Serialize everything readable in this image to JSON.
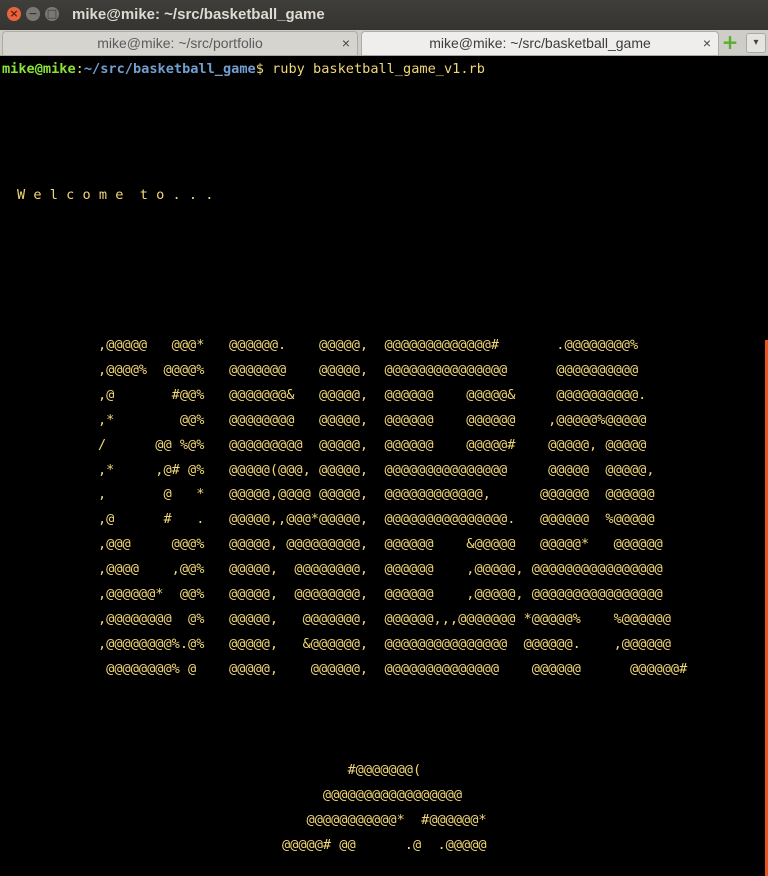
{
  "window": {
    "title": "mike@mike: ~/src/basketball_game",
    "close_icon": "×",
    "minimize_icon": "−",
    "maximize_icon": "□"
  },
  "tabs": [
    {
      "label": "mike@mike: ~/src/portfolio",
      "active": false,
      "close": "×"
    },
    {
      "label": "mike@mike: ~/src/basketball_game",
      "active": true,
      "close": "×"
    }
  ],
  "new_tab_icon": "+",
  "menu_icon": "▾",
  "terminal": {
    "prompt_user": "mike@mike",
    "prompt_colon": ":",
    "prompt_path": "~/src/basketball_game",
    "prompt_symbol": "$",
    "command": " ruby basketball_game_v1.rb",
    "welcome": "W e l c o m e  t o . . .",
    "art": ",@@@@@   @@@*   @@@@@@.    @@@@@,  @@@@@@@@@@@@@#       .@@@@@@@@%\n,@@@@%  @@@@%   @@@@@@@    @@@@@,  @@@@@@@@@@@@@@@      @@@@@@@@@@\n,@       #@@%   @@@@@@@&   @@@@@,  @@@@@@    @@@@@&     @@@@@@@@@@.\n,*        @@%   @@@@@@@@   @@@@@,  @@@@@@    @@@@@@    ,@@@@@%@@@@@\n/      @@ %@%   @@@@@@@@@  @@@@@,  @@@@@@    @@@@@#    @@@@@, @@@@@\n,*     ,@# @%   @@@@@(@@@, @@@@@,  @@@@@@@@@@@@@@@     @@@@@  @@@@@,\n,       @   *   @@@@@,@@@@ @@@@@,  @@@@@@@@@@@@,      @@@@@@  @@@@@@\n,@      #   .   @@@@@,,@@@*@@@@@,  @@@@@@@@@@@@@@@.   @@@@@@  %@@@@@\n,@@@     @@@%   @@@@@, @@@@@@@@@,  @@@@@@    &@@@@@   @@@@@*   @@@@@@\n,@@@@    ,@@%   @@@@@,  @@@@@@@@,  @@@@@@    ,@@@@@, @@@@@@@@@@@@@@@@\n,@@@@@@*  @@%   @@@@@,  @@@@@@@@,  @@@@@@    ,@@@@@, @@@@@@@@@@@@@@@@\n,@@@@@@@@  @%   @@@@@,   @@@@@@@,  @@@@@@,,,@@@@@@@ *@@@@@%    %@@@@@@\n,@@@@@@@@%.@%   @@@@@,   &@@@@@@,  @@@@@@@@@@@@@@@  @@@@@@.    ,@@@@@@\n @@@@@@@@% @    @@@@@,    @@@@@@,  @@@@@@@@@@@@@@    @@@@@@      @@@@@@#",
    "ball": "        #@@@@@@@(\n     @@@@@@@@@@@@@@@@@\n   @@@@@@@@@@@*  #@@@@@@*\n@@@@@# @@      .@  .@@@@@"
  }
}
